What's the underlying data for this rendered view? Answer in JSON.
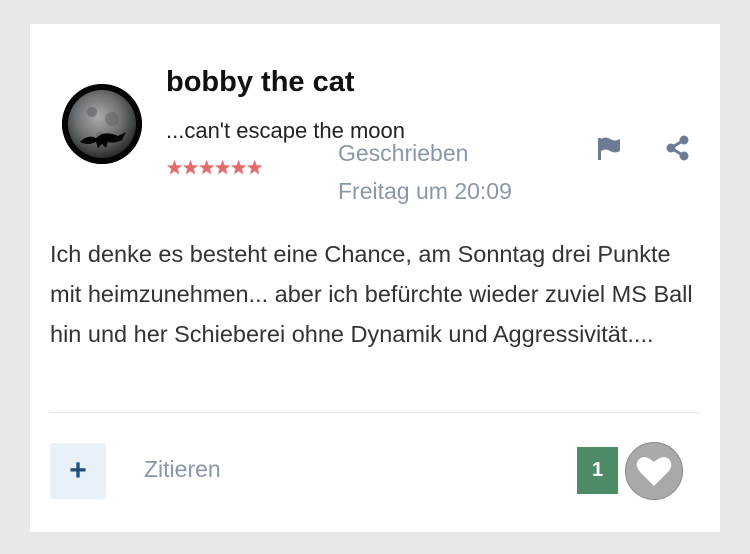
{
  "post": {
    "author_name": "bobby the cat",
    "author_tagline": "...can't escape the moon",
    "author_rank_stars": "★★★★★★",
    "posted_label": "Geschrieben",
    "posted_time": "Freitag um 20:09",
    "body": "Ich denke es besteht eine Chance, am Sonntag drei Punkte mit heimzunehmen... aber ich befürchte wieder zuviel MS Ball hin und her Schieberei ohne Dynamik und Aggressivität...."
  },
  "actions": {
    "add_symbol": "+",
    "quote_label": "Zitieren",
    "like_count": "1"
  },
  "colors": {
    "accent_blue": "#1f4e79",
    "meta_gray": "#8a97a8",
    "like_green": "#4e8c68",
    "star_red": "#e66a6a"
  },
  "icons": {
    "report": "flag-icon",
    "share": "share-icon",
    "like": "heart-icon"
  }
}
